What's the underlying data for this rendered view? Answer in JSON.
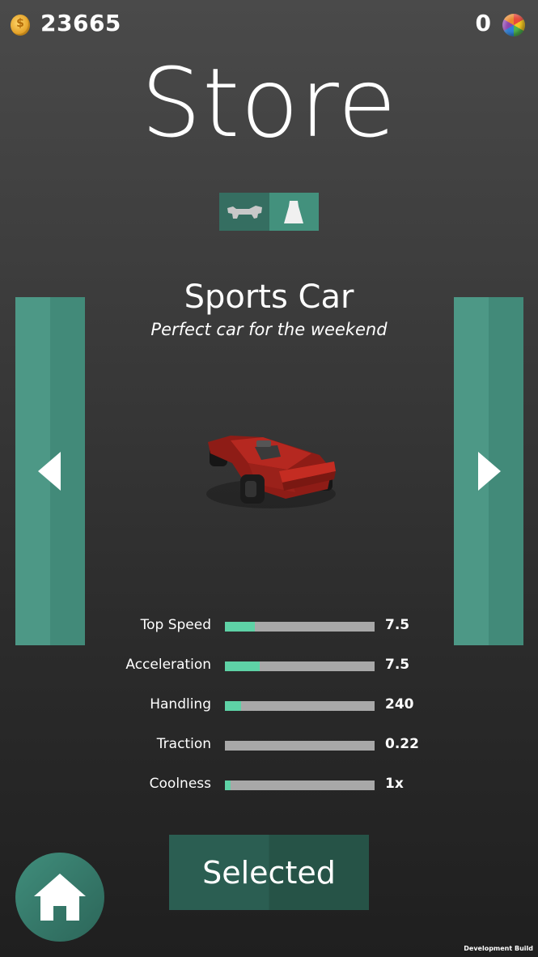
{
  "header": {
    "coins": "23665",
    "gems": "0",
    "coin_icon": "coin-icon",
    "gem_icon": "gem-ball-icon"
  },
  "title": "Store",
  "category_tabs": [
    {
      "icon": "car-icon",
      "selected": true
    },
    {
      "icon": "road-icon",
      "selected": false
    }
  ],
  "item": {
    "name": "Sports Car",
    "description": "Perfect car for the weekend",
    "color": "#b52820"
  },
  "stats": [
    {
      "label": "Top Speed",
      "value": "7.5",
      "fill": 0.2
    },
    {
      "label": "Acceleration",
      "value": "7.5",
      "fill": 0.23
    },
    {
      "label": "Handling",
      "value": "240",
      "fill": 0.11
    },
    {
      "label": "Traction",
      "value": "0.22",
      "fill": 0.0
    },
    {
      "label": "Coolness",
      "value": "1x",
      "fill": 0.04
    }
  ],
  "action_button": "Selected",
  "footer": {
    "home_icon": "home-icon",
    "build_label": "Development Build"
  },
  "colors": {
    "accent": "#43917d",
    "accent_dark": "#2b5e52",
    "bar_fill": "#5ed2a6",
    "bar_track": "#a8a8a8"
  }
}
